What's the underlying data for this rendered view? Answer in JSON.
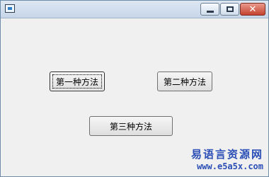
{
  "window": {
    "title": "",
    "controls": {
      "minimize": "minimize-icon",
      "maximize": "maximize-icon",
      "close": "close-icon"
    }
  },
  "buttons": {
    "method1": "第一种方法",
    "method2": "第二种方法",
    "method3": "第三种方法"
  },
  "watermark": {
    "line1": "易语言资源网",
    "line2": "www.e5a5x.com"
  },
  "colors": {
    "watermark": "#2b4fb6",
    "titlebar": "#c7d6e8",
    "client": "#f0f0f0"
  }
}
